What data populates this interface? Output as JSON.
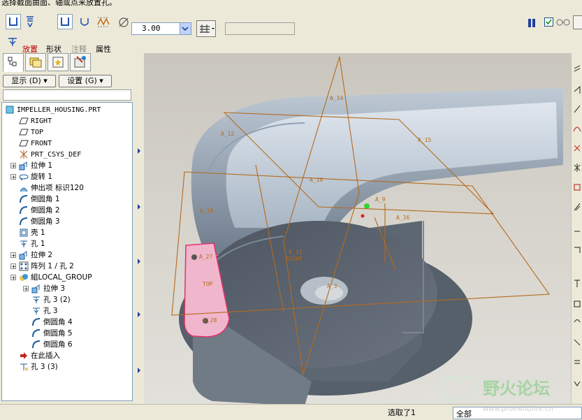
{
  "title_strip": "选择截面曲面、轴或点来放置孔。",
  "dashboard": {
    "depth_value": "3.00",
    "tabs": [
      {
        "label": "放置",
        "color": "#c00000"
      },
      {
        "label": "形状",
        "color": "#000000"
      },
      {
        "label": "注释",
        "color": "#8a8a8a"
      },
      {
        "label": "属性",
        "color": "#000000"
      }
    ]
  },
  "left_panel": {
    "show_button": "显示 (D) ▾",
    "settings_button": "设置 (G) ▾",
    "tree_root": "IMPELLER_HOUSING.PRT",
    "tree": [
      {
        "label": "RIGHT",
        "icon": "datum-plane-icon",
        "indent": 1,
        "expander": false
      },
      {
        "label": "TOP",
        "icon": "datum-plane-icon",
        "indent": 1,
        "expander": false
      },
      {
        "label": "FRONT",
        "icon": "datum-plane-icon",
        "indent": 1,
        "expander": false
      },
      {
        "label": "PRT_CSYS_DEF",
        "icon": "csys-icon",
        "indent": 1,
        "expander": false
      },
      {
        "label": "拉伸 1",
        "icon": "extrude-icon",
        "indent": 1,
        "expander": true
      },
      {
        "label": "旋转 1",
        "icon": "revolve-icon",
        "indent": 1,
        "expander": true
      },
      {
        "label": "伸出项 标识120",
        "icon": "protrusion-icon",
        "indent": 1,
        "expander": false
      },
      {
        "label": "倒圆角 1",
        "icon": "round-icon",
        "indent": 1,
        "expander": false
      },
      {
        "label": "倒圆角 2",
        "icon": "round-icon",
        "indent": 1,
        "expander": false
      },
      {
        "label": "倒圆角 3",
        "icon": "round-icon",
        "indent": 1,
        "expander": false
      },
      {
        "label": "壳 1",
        "icon": "shell-icon",
        "indent": 1,
        "expander": false
      },
      {
        "label": "孔 1",
        "icon": "hole-icon",
        "indent": 1,
        "expander": false
      },
      {
        "label": "拉伸 2",
        "icon": "extrude-icon",
        "indent": 1,
        "expander": true
      },
      {
        "label": "阵列 1 / 孔 2",
        "icon": "pattern-icon",
        "indent": 1,
        "expander": true
      },
      {
        "label": "組LOCAL_GROUP",
        "icon": "group-icon",
        "indent": 1,
        "expander": true
      },
      {
        "label": "拉伸 3",
        "icon": "extrude-icon",
        "indent": 2,
        "expander": true
      },
      {
        "label": "孔 3 (2)",
        "icon": "hole-icon",
        "indent": 2,
        "expander": false
      },
      {
        "label": "孔 3",
        "icon": "hole-icon",
        "indent": 2,
        "expander": false
      },
      {
        "label": "倒圆角 4",
        "icon": "round-icon",
        "indent": 2,
        "expander": false
      },
      {
        "label": "倒圆角 5",
        "icon": "round-icon",
        "indent": 2,
        "expander": false
      },
      {
        "label": "倒圆角 6",
        "icon": "round-icon",
        "indent": 2,
        "expander": false
      },
      {
        "label": "在此插入",
        "icon": "insert-arrow-icon",
        "indent": 1,
        "expander": false
      },
      {
        "label": "孔 3 (3)",
        "icon": "hole-new-icon",
        "indent": 1,
        "expander": false
      }
    ]
  },
  "viewport": {
    "datum_labels": [
      "A_14",
      "A_12",
      "A_15",
      "A_10",
      "A_18",
      "A_9",
      "A_16",
      "A_11",
      "RIGHT",
      "A_3",
      "A_27",
      "TOP",
      "A_28"
    ],
    "datum_color": "#b46a1e"
  },
  "status": {
    "message": "选取了1",
    "filter_value": "全部"
  },
  "watermark": {
    "text": "野火论坛",
    "url": "www.proewildfire.cn"
  }
}
